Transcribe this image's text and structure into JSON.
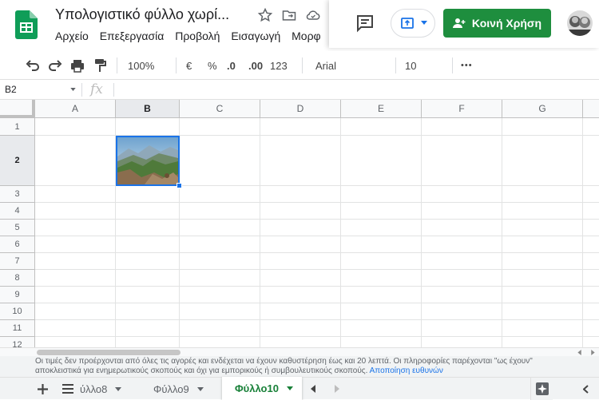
{
  "header": {
    "title": "Υπολογιστικό φύλλο χωρί...",
    "menu": [
      "Αρχείο",
      "Επεξεργασία",
      "Προβολή",
      "Εισαγωγή",
      "Μορφ"
    ],
    "share_label": "Κοινή Χρήση"
  },
  "toolbar": {
    "zoom": "100%",
    "currency": "€",
    "percent": "%",
    "dec_decrease": ".0",
    "dec_increase": ".00",
    "format_more": "123",
    "font": "Arial",
    "font_size": "10",
    "more": "•••"
  },
  "formula": {
    "cell_ref": "B2",
    "fx": "fx"
  },
  "grid": {
    "columns": [
      "A",
      "B",
      "C",
      "D",
      "E",
      "F",
      "G"
    ],
    "rows": [
      "1",
      "2",
      "3",
      "4",
      "5",
      "6",
      "7",
      "8",
      "9",
      "10",
      "11",
      "12"
    ]
  },
  "disclaimer": {
    "line1": "Οι τιμές δεν προέρχονται από όλες τις αγορές και ενδέχεται να έχουν καθυστέρηση έως και 20 λεπτά. Οι πληροφορίες παρέχονται \"ως έχουν\"",
    "line2": "αποκλειστικά για ενημερωτικούς σκοπούς και όχι για εμπορικούς ή συμβουλευτικούς σκοπούς.",
    "link": "Αποποίηση ευθυνών"
  },
  "tabs": [
    "ύλλο8",
    "Φύλλο9",
    "Φύλλο10"
  ],
  "colors": {
    "accent": "#1a73e8",
    "share": "#1e8e3e",
    "active_tab": "#188038"
  }
}
